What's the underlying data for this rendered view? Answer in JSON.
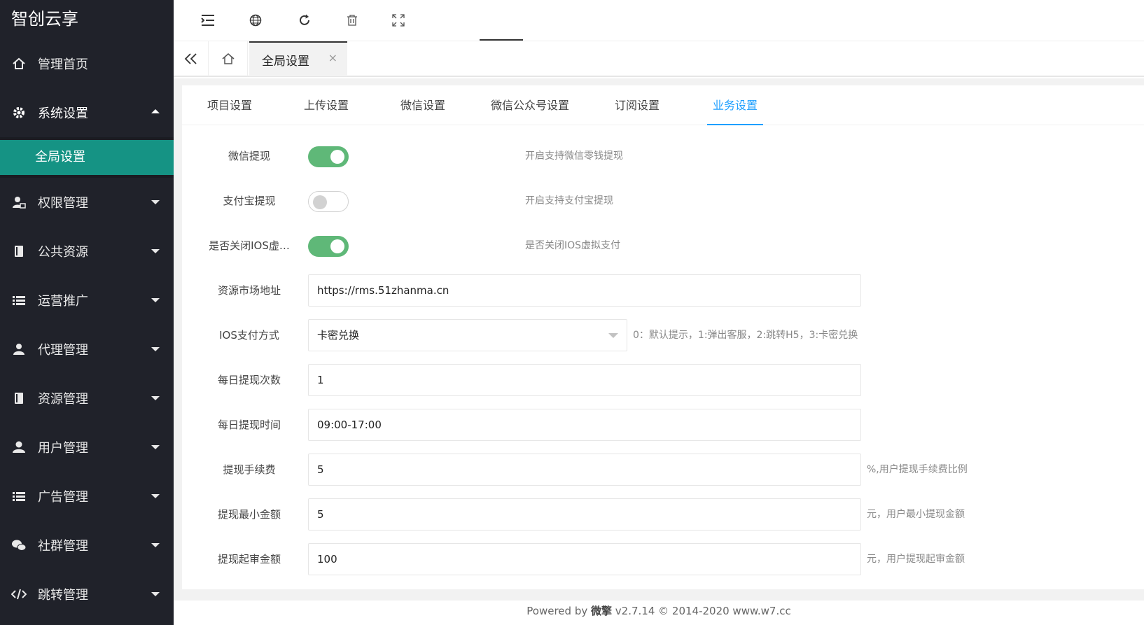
{
  "app": {
    "title": "智创云享"
  },
  "sidebar": {
    "items": [
      {
        "label": "管理首页",
        "icon": "home-icon"
      },
      {
        "label": "系统设置",
        "icon": "gear-icon",
        "expanded": true,
        "children": [
          {
            "label": "全局设置",
            "active": true
          }
        ]
      },
      {
        "label": "权限管理",
        "icon": "user-lock-icon"
      },
      {
        "label": "公共资源",
        "icon": "book-icon"
      },
      {
        "label": "运营推广",
        "icon": "list-icon"
      },
      {
        "label": "代理管理",
        "icon": "agent-icon"
      },
      {
        "label": "资源管理",
        "icon": "book-icon"
      },
      {
        "label": "用户管理",
        "icon": "user-icon"
      },
      {
        "label": "广告管理",
        "icon": "list-icon"
      },
      {
        "label": "社群管理",
        "icon": "wechat-icon"
      },
      {
        "label": "跳转管理",
        "icon": "code-icon"
      }
    ]
  },
  "toolbar": {
    "icons": [
      "menu-indent-icon",
      "globe-icon",
      "refresh-icon",
      "trash-icon",
      "fullscreen-icon"
    ]
  },
  "tabs": {
    "current": {
      "label": "全局设置",
      "close": "×"
    }
  },
  "subtabs": {
    "items": [
      "项目设置",
      "上传设置",
      "微信设置",
      "微信公众号设置",
      "订阅设置",
      "业务设置"
    ],
    "active_index": 5
  },
  "form": {
    "wechat_withdraw": {
      "label": "微信提现",
      "on": true,
      "hint": "开启支持微信零钱提现"
    },
    "alipay_withdraw": {
      "label": "支付宝提现",
      "on": false,
      "hint": "开启支持支付宝提现"
    },
    "ios_virtual_pay": {
      "label": "是否关闭IOS虚…",
      "on": true,
      "hint": "是否关闭IOS虚拟支付"
    },
    "resource_market_url": {
      "label": "资源市场地址",
      "value": "https://rms.51zhanma.cn"
    },
    "ios_pay_method": {
      "label": "IOS支付方式",
      "value": "卡密兑换",
      "hint": "0：默认提示，1:弹出客服，2:跳转H5，3:卡密兑换"
    },
    "daily_withdraw_count": {
      "label": "每日提现次数",
      "value": "1"
    },
    "daily_withdraw_time": {
      "label": "每日提现时间",
      "value": "09:00-17:00"
    },
    "withdraw_fee": {
      "label": "提现手续费",
      "value": "5",
      "hint": "%,用户提现手续费比例"
    },
    "withdraw_min": {
      "label": "提现最小金额",
      "value": "5",
      "hint": "元，用户最小提现金额"
    },
    "withdraw_audit_amount": {
      "label": "提现起审金额",
      "value": "100",
      "hint": "元，用户提现起审金额"
    }
  },
  "footer": {
    "prefix": "Powered by ",
    "brand": "微擎",
    "suffix": " v2.7.14 © 2014-2020 www.w7.cc"
  },
  "colors": {
    "sidebar_bg": "#20222a",
    "sidebar_active": "#159384",
    "switch_on": "#5fb878",
    "tab_active": "#1e9fff"
  }
}
